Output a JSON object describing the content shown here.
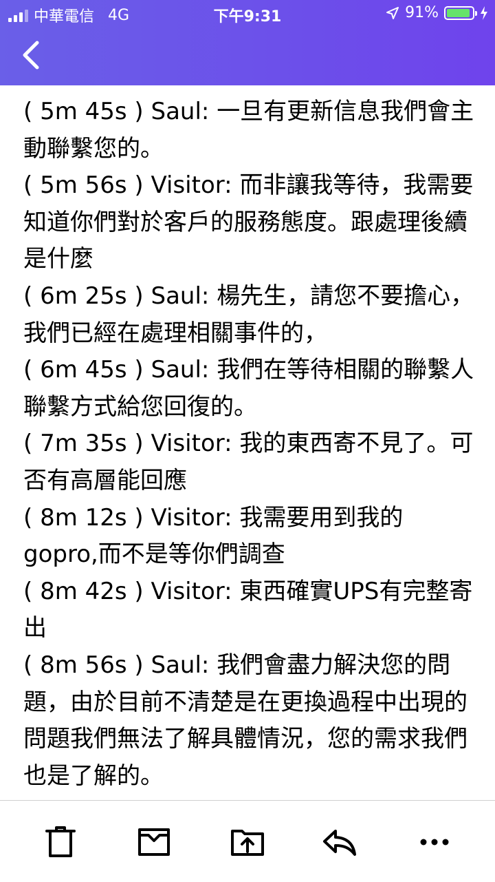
{
  "status_bar": {
    "carrier": "中華電信",
    "network": "4G",
    "time": "下午9:31",
    "battery_percent": "91%",
    "battery_level": 0.91,
    "battery_color": "#66e36a"
  },
  "header": {
    "accent_gradient": [
      "#6a5fe8",
      "#6f43ec"
    ],
    "back_icon": "chevron-left-icon"
  },
  "messages": [
    {
      "time": "( 5m 45s )",
      "speaker": "Saul:",
      "text": "一旦有更新信息我們會主動聯繫您的。"
    },
    {
      "time": "( 5m 56s )",
      "speaker": "Visitor:",
      "text": "而非讓我等待，我需要知道你們對於客戶的服務態度。跟處理後續是什麼"
    },
    {
      "time": "( 6m 25s )",
      "speaker": "Saul:",
      "text": "楊先生，請您不要擔心，我們已經在處理相關事件的，"
    },
    {
      "time": "( 6m 45s )",
      "speaker": "Saul:",
      "text": "我們在等待相關的聯繫人聯繫方式給您回復的。"
    },
    {
      "time": "( 7m 35s )",
      "speaker": "Visitor:",
      "text": "我的東西寄不見了。可否有高層能回應"
    },
    {
      "time": "( 8m 12s )",
      "speaker": "Visitor:",
      "text": "我需要用到我的gopro,而不是等你們調查"
    },
    {
      "time": "( 8m 42s )",
      "speaker": "Visitor:",
      "text": "東西確實UPS有完整寄出"
    },
    {
      "time": "( 8m 56s )",
      "speaker": "Saul:",
      "text": "我們會盡力解決您的問題，由於目前不清楚是在更換過程中出現的問題我們無法了解具體情況，您的需求我們也是了解的。"
    }
  ],
  "toolbar": {
    "icons": [
      "trash-icon",
      "archive-icon",
      "move-to-folder-icon",
      "reply-icon",
      "more-icon"
    ]
  }
}
